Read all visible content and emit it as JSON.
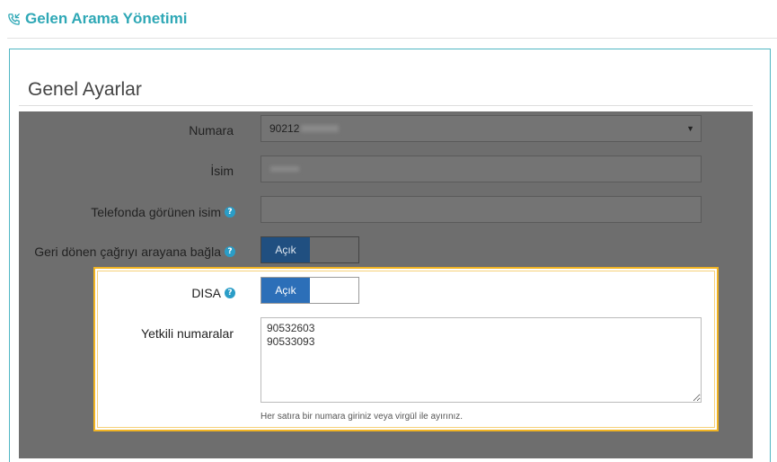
{
  "header": {
    "title": "Gelen Arama Yönetimi",
    "icon": "phone-incoming-icon"
  },
  "section": {
    "title": "Genel Ayarlar"
  },
  "form": {
    "numara": {
      "label": "Numara",
      "value_prefix": "90212"
    },
    "isim": {
      "label": "İsim"
    },
    "telefon_isim": {
      "label": "Telefonda görünen isim",
      "value": ""
    },
    "geri_donen": {
      "label": "Geri dönen çağrıyı arayana bağla",
      "toggle_on_label": "Açık"
    },
    "disa": {
      "label": "DISA",
      "toggle_on_label": "Açık"
    },
    "yetkili": {
      "label": "Yetkili numaralar",
      "value": "90532603\n90533093",
      "hint": "Her satıra bir numara giriniz veya virgül ile ayırınız."
    }
  },
  "colors": {
    "accent": "#2fa8b6",
    "highlight_border": "#f0b323",
    "toggle_on": "#2c6fb8",
    "overlay": "#6e6e6e"
  }
}
